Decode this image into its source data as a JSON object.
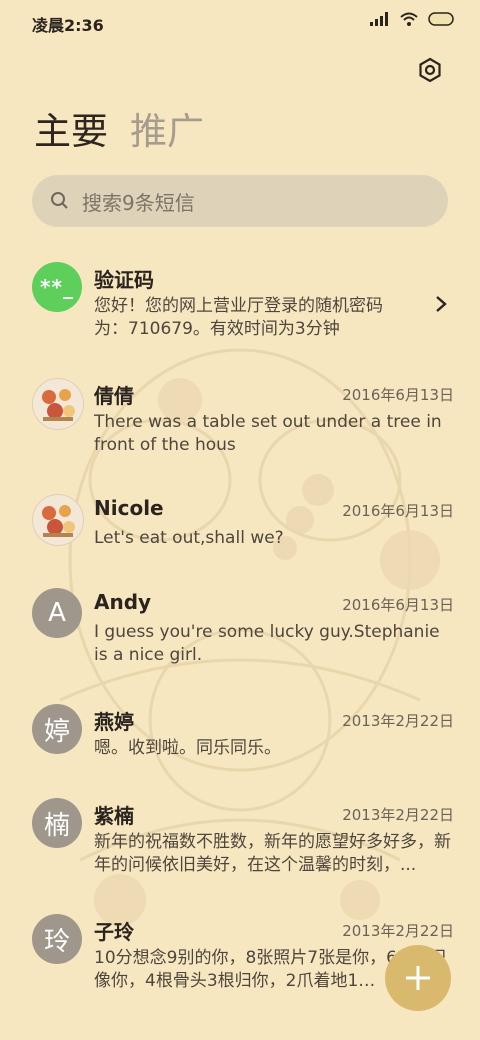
{
  "status": {
    "time": "凌晨2:36"
  },
  "tabs": [
    {
      "label": "主要"
    },
    {
      "label": "推广"
    }
  ],
  "search": {
    "placeholder": "搜索9条短信"
  },
  "messages": [
    {
      "name": "验证码",
      "date": "",
      "avatar_text": "**_",
      "preview": "您好！您的网上营业厅登录的随机密码为：710679。有效时间为3分钟"
    },
    {
      "name": "倩倩",
      "date": "2016年6月13日",
      "avatar_text": "",
      "preview": "There was a table set out under a tree in front of the hous"
    },
    {
      "name": "Nicole",
      "date": "2016年6月13日",
      "avatar_text": "",
      "preview": "Let's eat out,shall we?"
    },
    {
      "name": "Andy",
      "date": "2016年6月13日",
      "avatar_text": "A",
      "preview": "I guess you're some lucky guy.Stephanie is a nice girl."
    },
    {
      "name": "燕婷",
      "date": "2013年2月22日",
      "avatar_text": "婷",
      "preview": "嗯。收到啦。同乐同乐。"
    },
    {
      "name": "紫楠",
      "date": "2013年2月22日",
      "avatar_text": "楠",
      "preview": "新年的祝福数不胜数，新年的愿望好多好多，新年的问候依旧美好，在这个温馨的时刻，..."
    },
    {
      "name": "子玲",
      "date": "2013年2月22日",
      "avatar_text": "玲",
      "preview": "10分想念9别的你，8张照片7张是你，6… 5只像你，4根骨头3根归你，2爪着地1…"
    }
  ],
  "colors": {
    "background": "#f6e7c1",
    "fab": "#d9b96e",
    "code_avatar": "#5ecf5a",
    "letter_avatar": "#9f978b"
  },
  "icons": {
    "settings": "gear-icon",
    "search": "search-icon",
    "compose": "plus-icon",
    "open": "chevron-right-icon"
  }
}
